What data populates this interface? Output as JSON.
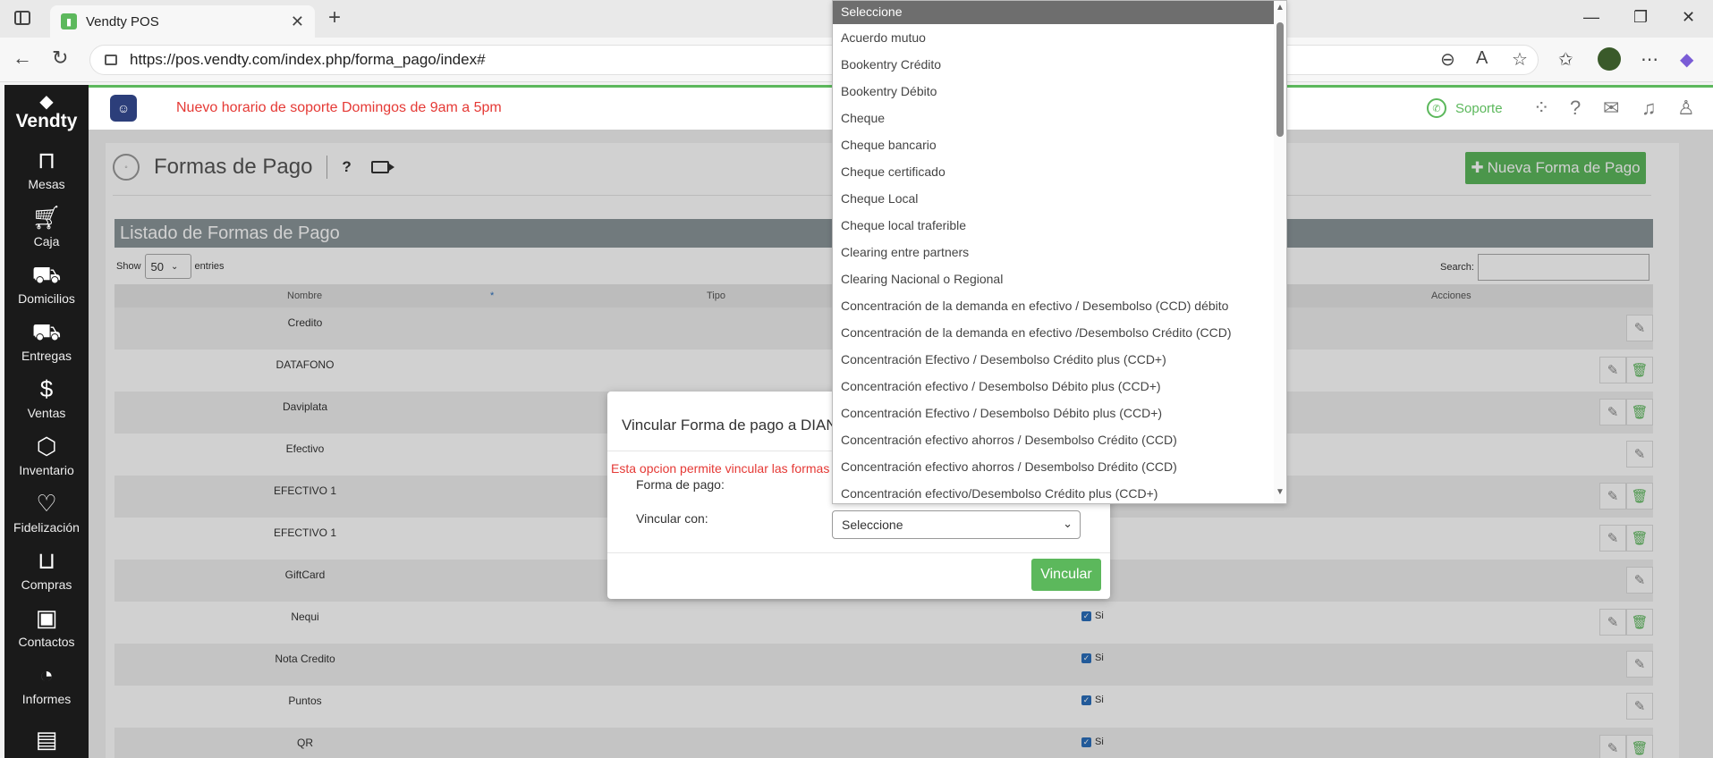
{
  "browser": {
    "tab_title": "Vendty POS",
    "url": "https://pos.vendty.com/index.php/forma_pago/index#"
  },
  "sidebar": {
    "logo": "Vendty",
    "items": [
      {
        "label": "Mesas",
        "icon": "tables-icon"
      },
      {
        "label": "Caja",
        "icon": "cart-icon"
      },
      {
        "label": "Domicilios",
        "icon": "delivery-icon"
      },
      {
        "label": "Entregas",
        "icon": "truck-icon"
      },
      {
        "label": "Ventas",
        "icon": "money-bag-icon"
      },
      {
        "label": "Inventario",
        "icon": "box-icon"
      },
      {
        "label": "Fidelización",
        "icon": "heart-icon"
      },
      {
        "label": "Compras",
        "icon": "shopping-bag-icon"
      },
      {
        "label": "Contactos",
        "icon": "contacts-icon"
      },
      {
        "label": "Informes",
        "icon": "pie-chart-icon"
      }
    ]
  },
  "topbar": {
    "notice": "Nuevo horario de soporte Domingos de 9am a 5pm",
    "support_label": "Soporte"
  },
  "page": {
    "title": "Formas de Pago",
    "help": "?",
    "new_button": "Nueva Forma de Pago",
    "list_title": "Listado de Formas de Pago",
    "show_label": "Show",
    "show_value": "50",
    "entries_label": "entries",
    "search_label": "Search:",
    "columns": {
      "nombre": "Nombre",
      "tipo": "Tipo",
      "acciones": "Acciones"
    },
    "rows": [
      {
        "name": "Credito",
        "check": "",
        "delete": false
      },
      {
        "name": "DATAFONO",
        "check": "",
        "delete": true
      },
      {
        "name": "Daviplata",
        "check": "",
        "delete": true
      },
      {
        "name": "Efectivo",
        "check": "",
        "delete": false
      },
      {
        "name": "EFECTIVO 1",
        "check": "",
        "delete": true
      },
      {
        "name": "EFECTIVO 1",
        "check": "",
        "delete": true
      },
      {
        "name": "GiftCard",
        "check": "",
        "delete": false
      },
      {
        "name": "Nequi",
        "check": "Si",
        "delete": true
      },
      {
        "name": "Nota Credito",
        "check": "Si",
        "delete": false
      },
      {
        "name": "Puntos",
        "check": "Si",
        "delete": false
      },
      {
        "name": "QR",
        "check": "Si",
        "delete": true
      }
    ]
  },
  "modal": {
    "title": "Vincular Forma de pago a DIAN",
    "warning": "Esta opcion permite vincular las formas",
    "forma_label": "Forma de pago:",
    "vincular_label": "Vincular con:",
    "select_value": "Seleccione",
    "button": "Vincular"
  },
  "dropdown": {
    "options": [
      "Seleccione",
      "Acuerdo mutuo",
      "Bookentry Crédito",
      "Bookentry Débito",
      "Cheque",
      "Cheque bancario",
      "Cheque certificado",
      "Cheque Local",
      "Cheque local traferible",
      "Clearing entre partners",
      "Clearing Nacional o Regional",
      "Concentración de la demanda en efectivo / Desembolso (CCD) débito",
      "Concentración de la demanda en efectivo /Desembolso Crédito (CCD)",
      "Concentración Efectivo / Desembolso Crédito plus (CCD+)",
      "Concentración efectivo / Desembolso Débito plus (CCD+)",
      "Concentración Efectivo / Desembolso Débito plus (CCD+)",
      "Concentración efectivo ahorros / Desembolso Crédito (CCD)",
      "Concentración efectivo ahorros / Desembolso Drédito (CCD)",
      "Concentración efectivo/Desembolso Crédito plus (CCD+)"
    ]
  }
}
